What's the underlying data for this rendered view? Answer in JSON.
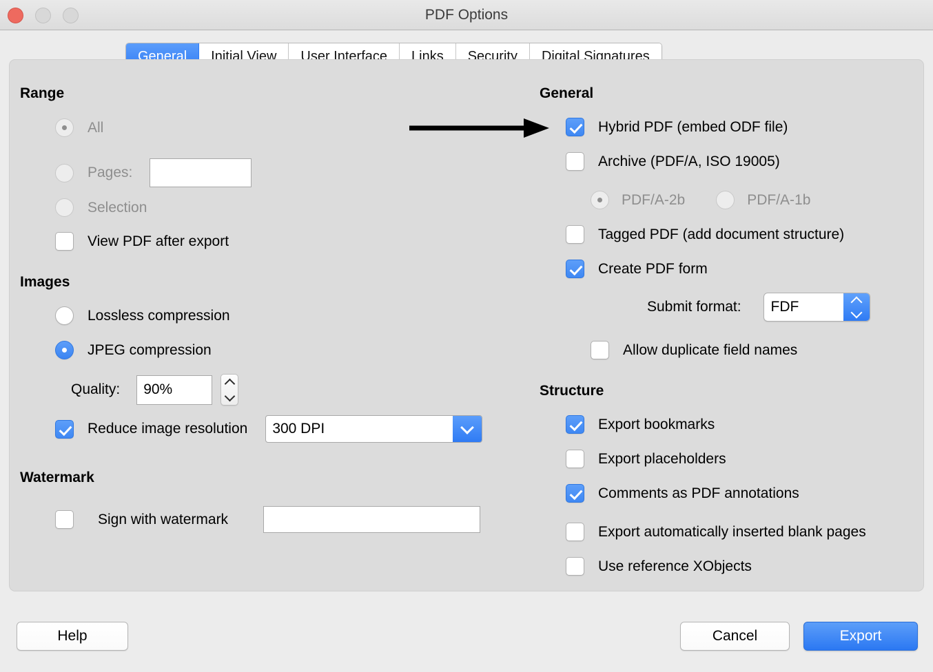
{
  "window": {
    "title": "PDF Options",
    "traffic_lights": [
      "close",
      "minimize",
      "maximize"
    ]
  },
  "tabs": [
    {
      "label": "General",
      "active": true
    },
    {
      "label": "Initial View",
      "active": false
    },
    {
      "label": "User Interface",
      "active": false
    },
    {
      "label": "Links",
      "active": false
    },
    {
      "label": "Security",
      "active": false
    },
    {
      "label": "Digital Signatures",
      "active": false
    }
  ],
  "left": {
    "range": {
      "title": "Range",
      "all": "All",
      "pages": "Pages:",
      "pages_value": "",
      "selection": "Selection",
      "view_pdf": "View PDF after export"
    },
    "images": {
      "title": "Images",
      "lossless": "Lossless compression",
      "jpeg": "JPEG compression",
      "quality_label": "Quality:",
      "quality_value": "90%",
      "reduce_resolution": "Reduce image resolution",
      "dpi_value": "300 DPI"
    },
    "watermark": {
      "title": "Watermark",
      "sign": "Sign with watermark",
      "text_value": ""
    }
  },
  "right": {
    "general": {
      "title": "General",
      "hybrid": "Hybrid PDF (embed ODF file)",
      "archive": "Archive (PDF/A, ISO 19005)",
      "pdfa_2b": "PDF/A-2b",
      "pdfa_1b": "PDF/A-1b",
      "tagged": "Tagged PDF (add document structure)",
      "create_form": "Create PDF form",
      "submit_format_label": "Submit format:",
      "submit_format_value": "FDF",
      "allow_duplicate": "Allow duplicate field names"
    },
    "structure": {
      "title": "Structure",
      "bookmarks": "Export bookmarks",
      "placeholders": "Export placeholders",
      "comments": "Comments as PDF annotations",
      "blank_pages": "Export automatically inserted blank pages",
      "xobjects": "Use reference XObjects"
    }
  },
  "footer": {
    "help": "Help",
    "cancel": "Cancel",
    "export": "Export"
  },
  "colors": {
    "accent_blue": "#3b84f2",
    "window_bg": "#ececec",
    "panel_bg": "#dcdcdc",
    "close_red": "#ee6a5f",
    "disabled_text": "#8e8e8e",
    "annotation_arrow": "#000000"
  }
}
